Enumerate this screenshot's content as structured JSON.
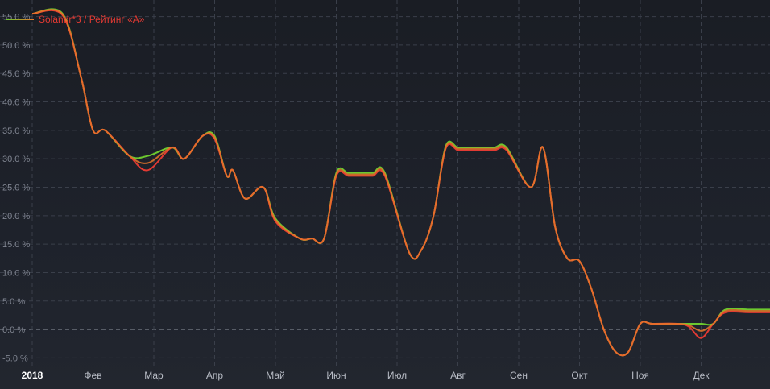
{
  "chart_data": {
    "type": "line",
    "title": "",
    "xlabel": "",
    "ylabel": "",
    "x_tick_labels": [
      "2018",
      "Фев",
      "Мар",
      "Апр",
      "Май",
      "Июн",
      "Июл",
      "Авг",
      "Сен",
      "Окт",
      "Ноя",
      "Дек"
    ],
    "y_tick_labels": [
      "-5.0 %",
      "0.0 %",
      "5.0 %",
      "10.0 %",
      "15.0 %",
      "20.0 %",
      "25.0 %",
      "30.0 %",
      "35.0 %",
      "40.0 %",
      "45.0 %",
      "50.0 %",
      "55.0 %"
    ],
    "y_ticks": [
      -5,
      0,
      5,
      10,
      15,
      20,
      25,
      30,
      35,
      40,
      45,
      50,
      55
    ],
    "ylim": [
      -6.5,
      56.5
    ],
    "xlim": [
      0,
      12.4
    ],
    "grid": true,
    "legend_position": "top-left",
    "series": [
      {
        "name": "Solandr*3 / Рейтинг «А»",
        "color": "#e23a33",
        "x": [
          0,
          0.5,
          0.8,
          1.0,
          1.2,
          1.6,
          1.9,
          2.3,
          2.5,
          2.8,
          3.0,
          3.2,
          3.3,
          3.5,
          3.8,
          4.0,
          4.4,
          4.6,
          4.8,
          5.0,
          5.2,
          5.4,
          5.6,
          5.8,
          6.2,
          6.4,
          6.6,
          6.8,
          7.0,
          7.2,
          7.4,
          7.6,
          7.8,
          8.2,
          8.4,
          8.6,
          8.8,
          9.0,
          9.2,
          9.4,
          9.6,
          9.8,
          10.0,
          10.2,
          10.6,
          10.8,
          11.0,
          11.2,
          11.4,
          11.8,
          12.4
        ],
        "values": [
          55.5,
          55.2,
          44.5,
          35,
          35,
          30.5,
          28,
          32,
          30,
          34,
          33.5,
          27,
          28,
          23,
          25,
          19,
          16,
          16,
          16,
          27,
          27,
          27,
          27,
          27,
          13.5,
          14,
          20,
          31.8,
          31.5,
          31.5,
          31.5,
          31.5,
          31.5,
          25,
          32,
          18,
          12.5,
          12,
          7,
          0,
          -4,
          -4,
          1,
          1,
          1,
          0.5,
          -1.5,
          1,
          3,
          3,
          3
        ]
      },
      {
        "name": "Рейтинг «А»",
        "color": "#6cc82f",
        "x": [
          0,
          0.5,
          0.8,
          1.0,
          1.2,
          1.6,
          1.9,
          2.3,
          2.5,
          2.8,
          3.0,
          3.2,
          3.3,
          3.5,
          3.8,
          4.0,
          4.4,
          4.6,
          4.8,
          5.0,
          5.2,
          5.4,
          5.6,
          5.8,
          6.2,
          6.4,
          6.6,
          6.8,
          7.0,
          7.2,
          7.4,
          7.6,
          7.8,
          8.2,
          8.4,
          8.6,
          8.8,
          9.0,
          9.2,
          9.4,
          9.6,
          9.8,
          10.0,
          10.2,
          10.6,
          10.8,
          11.0,
          11.2,
          11.4,
          11.8,
          12.4
        ],
        "values": [
          55.5,
          55.5,
          44.5,
          35,
          35,
          30.5,
          30.5,
          32,
          30,
          34,
          34,
          27,
          28,
          23,
          25,
          19.5,
          16,
          16,
          16,
          27.5,
          27.5,
          27.5,
          27.5,
          27.5,
          13.5,
          14,
          20,
          32.2,
          32,
          32,
          32,
          32,
          32,
          25,
          32,
          18,
          12.5,
          12,
          7,
          0,
          -4,
          -4,
          1,
          1,
          1,
          1,
          1,
          1,
          3.5,
          3.5,
          3.5
        ]
      }
    ]
  }
}
